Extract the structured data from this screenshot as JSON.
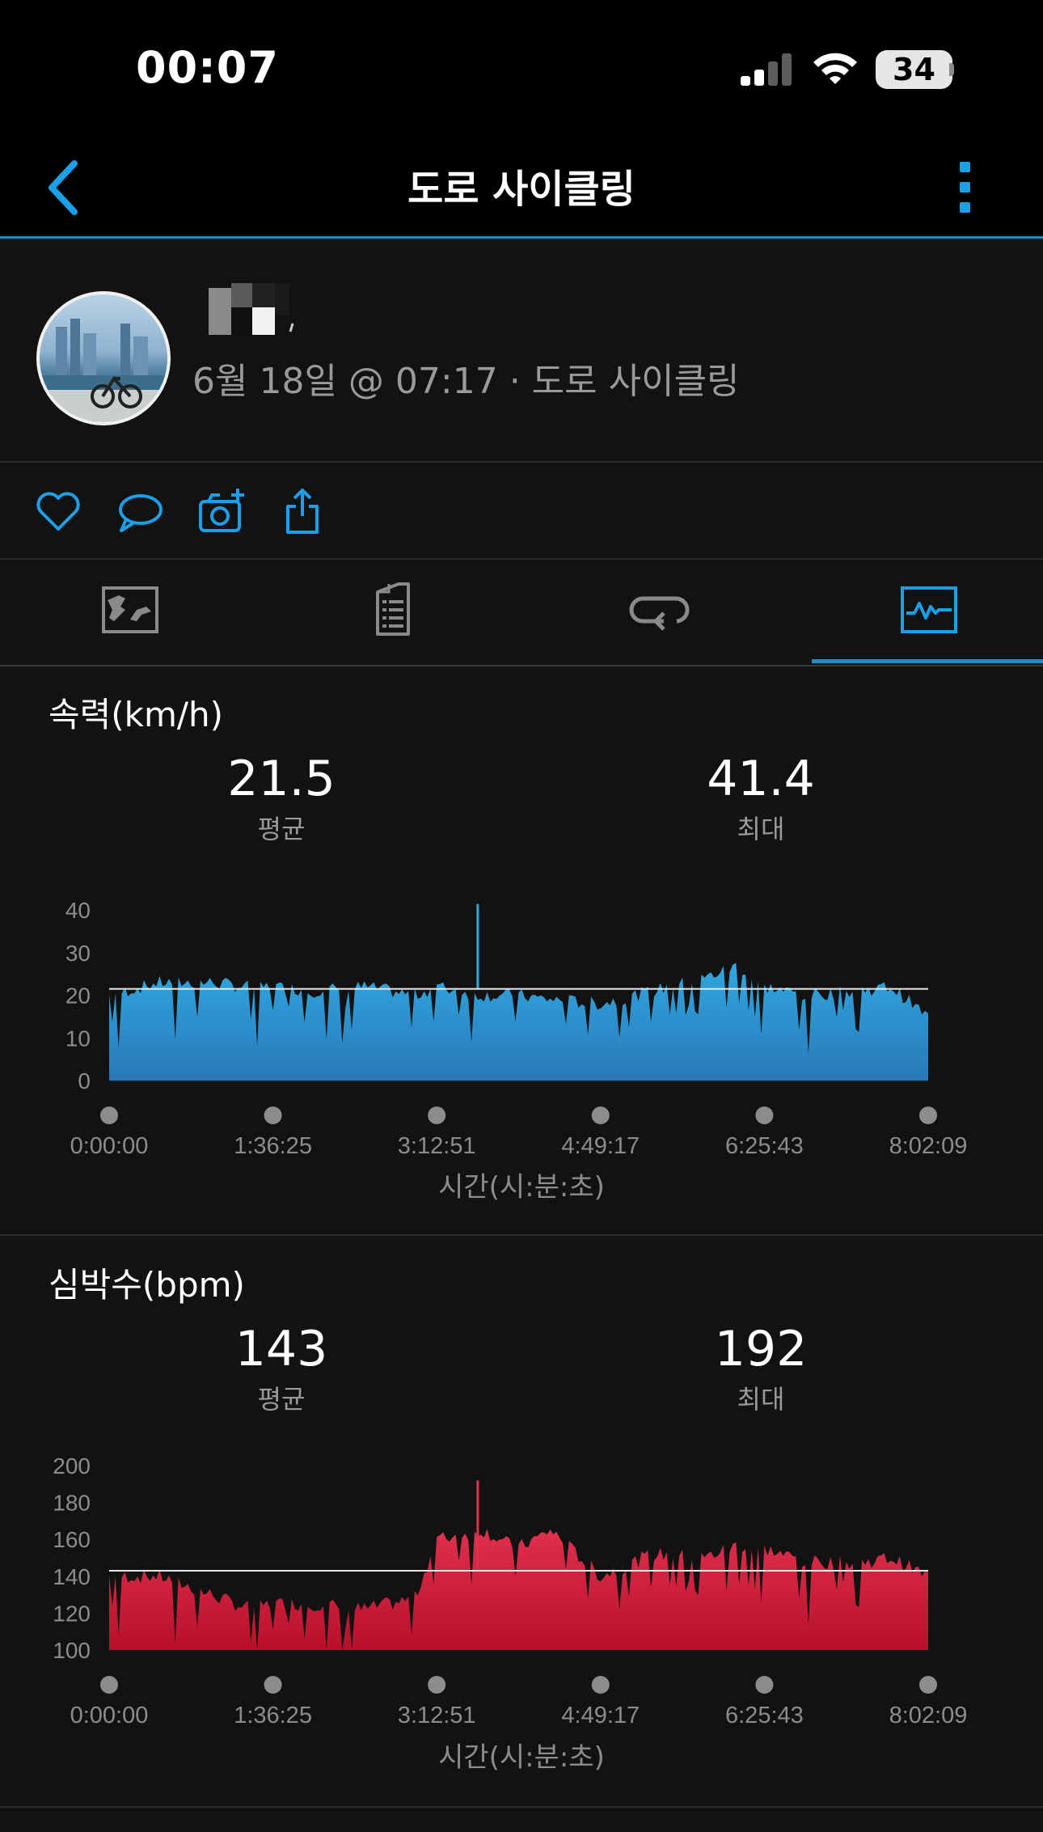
{
  "status_bar": {
    "time": "00:07",
    "battery": "34"
  },
  "nav": {
    "title": "도로 사이클링"
  },
  "profile": {
    "meta": "6월 18일 @ 07:17 · 도로 사이클링"
  },
  "actions": [
    "like-icon",
    "comment-icon",
    "add-photo-icon",
    "share-icon"
  ],
  "tabs": [
    "map-tab",
    "details-tab",
    "laps-tab",
    "charts-tab"
  ],
  "charts": [
    {
      "title": "속력(km/h)",
      "avg_value": "21.5",
      "avg_label": "평균",
      "max_value": "41.4",
      "max_label": "최대",
      "x_axis_title": "시간(시:분:초)",
      "color": "#2a9fd6"
    },
    {
      "title": "심박수(bpm)",
      "avg_value": "143",
      "avg_label": "평균",
      "max_value": "192",
      "max_label": "최대",
      "x_axis_title": "시간(시:분:초)",
      "color": "#d8203f"
    }
  ],
  "chart_data": [
    {
      "type": "area",
      "title": "속력(km/h)",
      "x": [
        "0:00:00",
        "0:30:00",
        "1:00:00",
        "1:20:00",
        "1:36:25",
        "2:00:00",
        "2:30:00",
        "3:00:00",
        "3:12:51",
        "3:40:00",
        "4:00:00",
        "4:20:00",
        "4:49:17",
        "5:20:00",
        "5:50:00",
        "6:10:00",
        "6:25:43",
        "6:50:00",
        "7:20:00",
        "7:40:00",
        "8:02:09"
      ],
      "values": [
        20,
        23,
        23,
        22,
        22,
        21,
        22,
        20,
        22,
        20,
        20,
        19,
        18,
        21,
        24,
        27,
        22,
        20,
        21,
        22,
        15
      ],
      "x_ticks": [
        "0:00:00",
        "1:36:25",
        "3:12:51",
        "4:49:17",
        "6:25:43",
        "8:02:09"
      ],
      "y_ticks": [
        0,
        10,
        20,
        30,
        40
      ],
      "ylim": [
        0,
        40
      ],
      "average": 21.5,
      "max": 41.4,
      "xlabel": "시간(시:분:초)"
    },
    {
      "type": "area",
      "title": "심박수(bpm)",
      "x": [
        "0:00:00",
        "0:30:00",
        "1:00:00",
        "1:20:00",
        "1:36:25",
        "2:00:00",
        "2:30:00",
        "3:00:00",
        "3:12:51",
        "3:40:00",
        "4:00:00",
        "4:20:00",
        "4:49:17",
        "5:20:00",
        "5:50:00",
        "6:10:00",
        "6:25:43",
        "6:50:00",
        "7:20:00",
        "7:40:00",
        "8:02:09"
      ],
      "values": [
        140,
        140,
        130,
        123,
        125,
        125,
        122,
        128,
        160,
        165,
        155,
        165,
        140,
        152,
        150,
        157,
        155,
        148,
        147,
        150,
        140
      ],
      "x_ticks": [
        "0:00:00",
        "1:36:25",
        "3:12:51",
        "4:49:17",
        "6:25:43",
        "8:02:09"
      ],
      "y_ticks": [
        100,
        120,
        140,
        160,
        180,
        200
      ],
      "ylim": [
        100,
        200
      ],
      "average": 143,
      "max": 192,
      "xlabel": "시간(시:분:초)"
    }
  ]
}
